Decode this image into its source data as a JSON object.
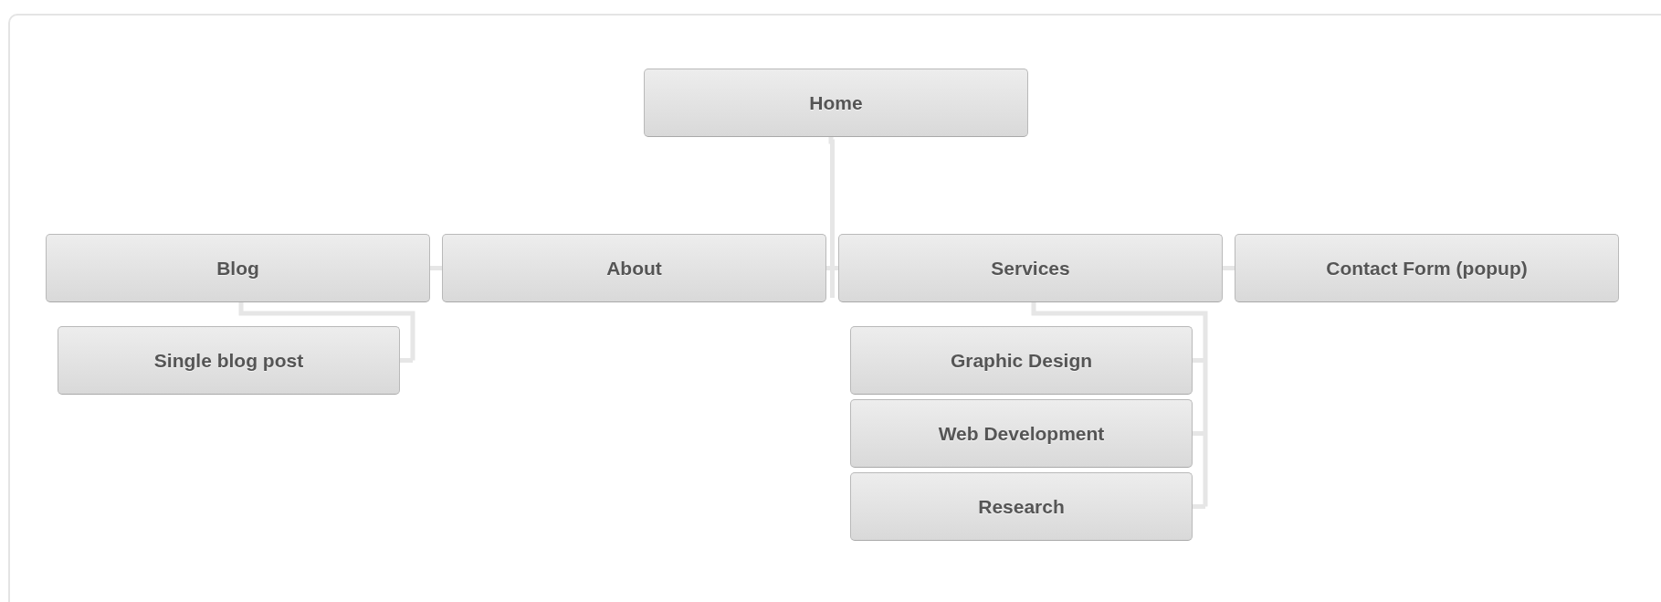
{
  "sitemap": {
    "root": {
      "label": "Home",
      "children": [
        {
          "label": "Blog",
          "children": [
            {
              "label": "Single blog post"
            }
          ]
        },
        {
          "label": "About"
        },
        {
          "label": "Services",
          "children": [
            {
              "label": "Graphic Design"
            },
            {
              "label": "Web Development"
            },
            {
              "label": "Research"
            }
          ]
        },
        {
          "label": "Contact Form (popup)"
        }
      ]
    }
  }
}
